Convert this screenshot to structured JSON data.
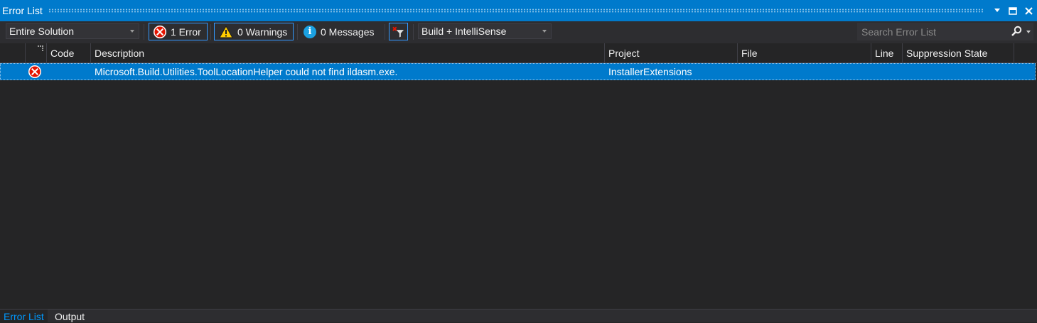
{
  "window": {
    "title": "Error List",
    "dropdown_icon": "chevron-down-icon",
    "maximize_icon": "maximize-icon",
    "close_icon": "close-icon"
  },
  "toolbar": {
    "scope_selected": "Entire Solution",
    "errors_label": "1 Error",
    "warnings_label": "0 Warnings",
    "messages_label": "0 Messages",
    "clear_filter_icon": "clear-filter-icon",
    "source_selected": "Build + IntelliSense",
    "search_placeholder": "Search Error List",
    "search_icon": "search-icon"
  },
  "columns": [
    "Code",
    "Description",
    "Project",
    "File",
    "Line",
    "Suppression State"
  ],
  "rows": [
    {
      "severity_icon": "error-icon",
      "code": "",
      "description": "Microsoft.Build.Utilities.ToolLocationHelper could not find ildasm.exe.",
      "project": "InstallerExtensions",
      "file": "",
      "line": "",
      "suppression_state": "",
      "selected": true
    }
  ],
  "bottom_tabs": [
    {
      "label": "Error List",
      "active": true
    },
    {
      "label": "Output",
      "active": false
    }
  ],
  "colors": {
    "accent": "#007acc",
    "background": "#252526",
    "toolbar": "#2d2d30",
    "error": "#e51400",
    "warning": "#ffcc00",
    "info": "#1ba1e2",
    "active_tab_text": "#0097fb"
  }
}
